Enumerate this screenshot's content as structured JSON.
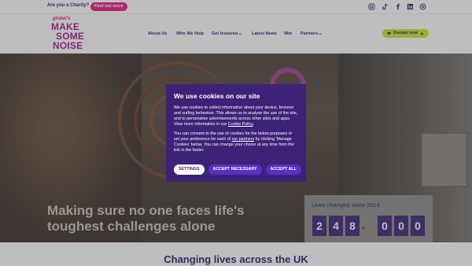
{
  "topbar": {
    "charity_question": "Are you a Charity?",
    "find_out_label": "Find out more",
    "social_icons": [
      "instagram-icon",
      "tiktok-icon",
      "facebook-icon",
      "linkedin-icon",
      "threads-icon"
    ]
  },
  "header": {
    "logo_small": "global's",
    "logo_lines": [
      "MAKE",
      "SOME",
      "NOISE"
    ],
    "nav": [
      {
        "label": "About Us",
        "dropdown": false
      },
      {
        "label": "Who We Help",
        "dropdown": false
      },
      {
        "label": "Get Involved",
        "dropdown": true
      },
      {
        "label": "Latest News",
        "dropdown": false
      },
      {
        "label": "Win",
        "dropdown": false
      },
      {
        "label": "Partners",
        "dropdown": true
      }
    ],
    "donate_label": "Donate now"
  },
  "hero": {
    "headline": "Making sure no one faces life's toughest challenges alone",
    "lives_label": "Lives changed since 2014",
    "digits": [
      "2",
      "4",
      "8",
      ",",
      "0",
      "0",
      "0"
    ]
  },
  "section": {
    "heading": "Changing lives across the UK"
  },
  "cookie": {
    "title": "We use cookies on our site",
    "para1": "We use cookies to collect information about your device, browser and surfing behaviour. This allows us to analyse the use of the site, and to personalise advertisements across other sites and apps. View more information in our ",
    "cookie_policy_link": "Cookie Policy",
    "para1_end": ".",
    "para2_start": "You can consent to the use of cookies for the below purposes or set your preference for each of ",
    "partners_link": "our partners",
    "para2_end": " by clicking 'Manage Cookies' below. You can change your choice at any time from the link in the footer.",
    "buttons": {
      "settings": "SETTINGS",
      "necessary": "ACCEPT NECESSARY",
      "accept_all": "ACCEPT ALL"
    }
  },
  "colors": {
    "brand_purple": "#3d2278",
    "brand_pink": "#e8177f",
    "donate_green": "#c9e52c"
  }
}
